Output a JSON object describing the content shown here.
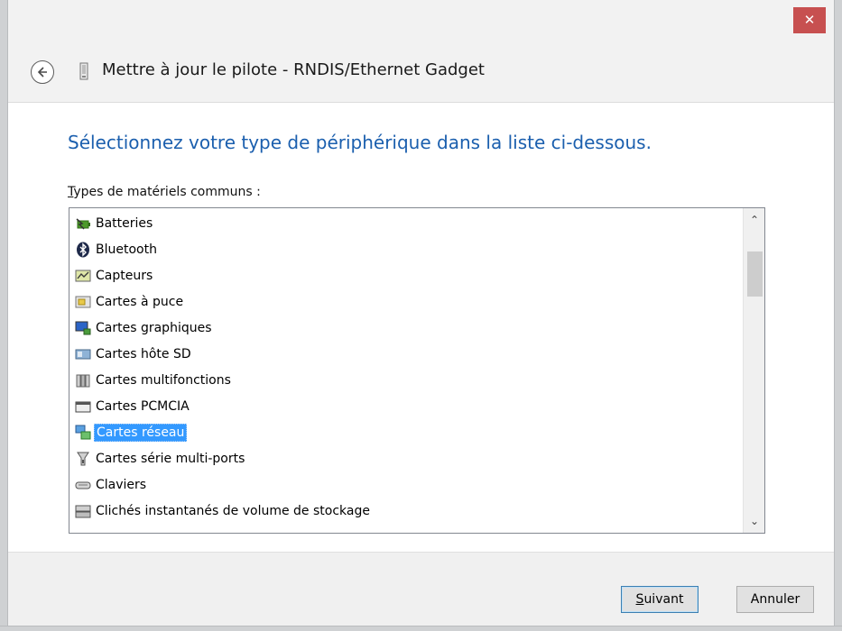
{
  "window": {
    "title": "Mettre à jour le pilote - RNDIS/Ethernet Gadget",
    "close_glyph": "✕"
  },
  "content": {
    "heading": "Sélectionnez votre type de périphérique dans la liste ci-dessous.",
    "list_label_accel": "T",
    "list_label_rest": "ypes de matériels communs :"
  },
  "list": {
    "items": [
      {
        "label": "Batteries",
        "icon": "battery-icon"
      },
      {
        "label": "Bluetooth",
        "icon": "bluetooth-icon"
      },
      {
        "label": "Capteurs",
        "icon": "sensor-icon"
      },
      {
        "label": "Cartes à puce",
        "icon": "smart-card-icon"
      },
      {
        "label": "Cartes graphiques",
        "icon": "display-adapter-icon"
      },
      {
        "label": "Cartes hôte SD",
        "icon": "sd-host-icon"
      },
      {
        "label": "Cartes multifonctions",
        "icon": "multifunction-card-icon"
      },
      {
        "label": "Cartes PCMCIA",
        "icon": "pcmcia-icon"
      },
      {
        "label": "Cartes réseau",
        "icon": "network-adapter-icon",
        "selected": true
      },
      {
        "label": "Cartes série multi-ports",
        "icon": "multiport-serial-icon"
      },
      {
        "label": "Claviers",
        "icon": "keyboard-icon"
      },
      {
        "label": "Clichés instantanés de volume de stockage",
        "icon": "storage-snapshot-icon"
      }
    ],
    "scroll_up_glyph": "⌃",
    "scroll_down_glyph": "⌄"
  },
  "footer": {
    "next_accel": "S",
    "next_rest": "uivant",
    "cancel_label": "Annuler"
  },
  "colors": {
    "heading": "#1b5fae",
    "selection": "#3399ff",
    "close": "#c75050"
  }
}
